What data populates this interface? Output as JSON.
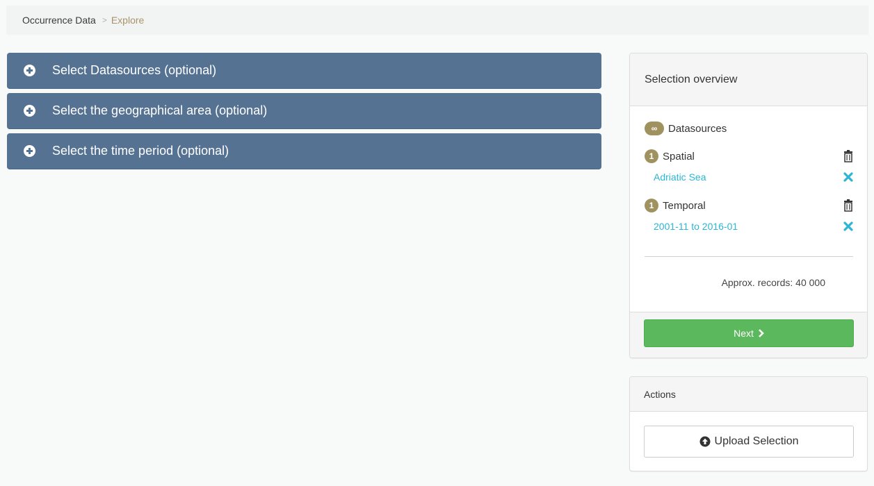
{
  "breadcrumb": {
    "items": [
      "Occurrence Data",
      "Explore"
    ],
    "separator": ">"
  },
  "accordion": [
    {
      "label": "Select Datasources (optional)",
      "icon": "plus-circle-icon"
    },
    {
      "label": "Select the geographical area (optional)",
      "icon": "plus-circle-icon"
    },
    {
      "label": "Select the time period (optional)",
      "icon": "plus-circle-icon"
    }
  ],
  "overview": {
    "title": "Selection overview",
    "datasources": {
      "badge": "∞",
      "label": "Datasources"
    },
    "spatial": {
      "badge": "1",
      "label": "Spatial",
      "value": "Adriatic Sea"
    },
    "temporal": {
      "badge": "1",
      "label": "Temporal",
      "value": "2001-11 to 2016-01"
    },
    "records_label": "Approx. records:",
    "records_value": "40 000",
    "next_label": "Next"
  },
  "actions": {
    "title": "Actions",
    "upload_label": "Upload Selection"
  },
  "colors": {
    "accordion_bg": "#557292",
    "badge": "#a0925f",
    "link": "#2bb6d3",
    "next_button": "#5cb85c",
    "breadcrumb_active": "#a8946a"
  }
}
